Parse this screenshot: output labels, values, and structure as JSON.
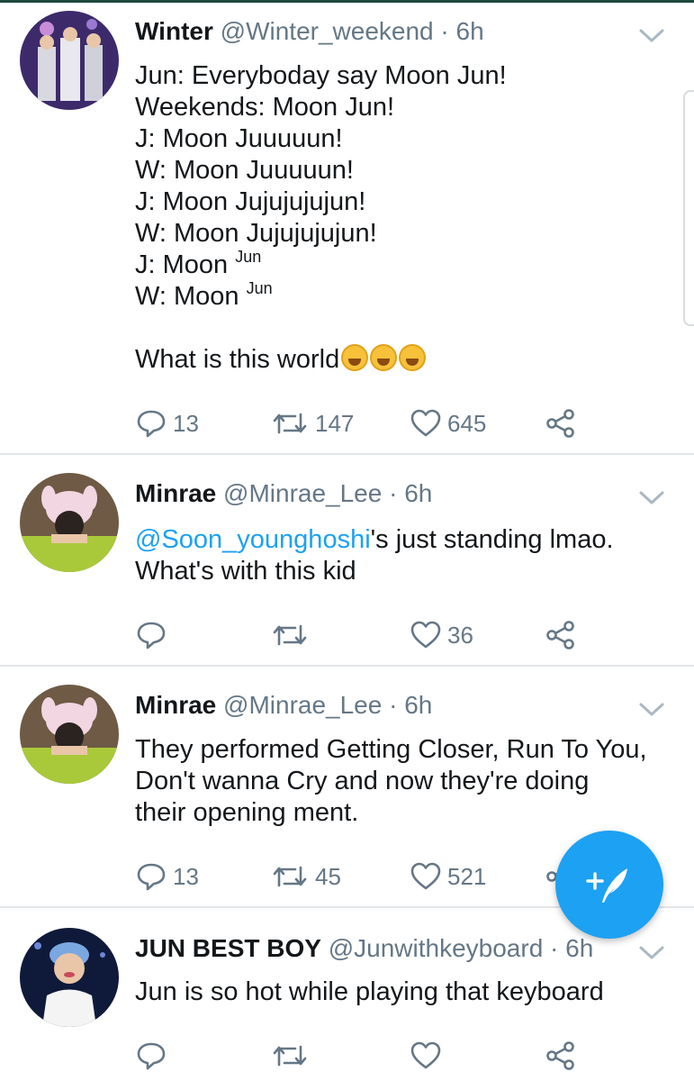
{
  "tweets": [
    {
      "name": "Winter",
      "handle": "@Winter_weekend",
      "time": "· 6h",
      "lines": [
        "Jun: Everyboday say Moon Jun!",
        "Weekends: Moon Jun!",
        "J: Moon Juuuuun!",
        "W: Moon Juuuuun!",
        "J: Moon Jujujujujun!",
        "W: Moon Jujujujujun!"
      ],
      "sup_lines": [
        {
          "prefix": "J: Moon ",
          "sup": "Jun"
        },
        {
          "prefix": "W: Moon ",
          "sup": "Jun"
        }
      ],
      "last_line": "What is this world",
      "emoji": [
        "grinning-squinting-face",
        "grinning-squinting-face",
        "grinning-squinting-face"
      ],
      "replies": "13",
      "retweets": "147",
      "likes": "645"
    },
    {
      "name": "Minrae",
      "handle": "@Minrae_Lee",
      "time": "· 6h",
      "mention": "@Soon_younghoshi",
      "line1_rest": "'s just standing lmao.",
      "line2": "What's with this kid",
      "replies": "",
      "retweets": "",
      "likes": "36"
    },
    {
      "name": "Minrae",
      "handle": "@Minrae_Lee",
      "time": "· 6h",
      "lines": [
        "They performed Getting Closer, Run To You,",
        "Don't wanna Cry and now they're doing",
        "their opening ment."
      ],
      "replies": "13",
      "retweets": "45",
      "likes": "521"
    },
    {
      "name": "JUN BEST BOY",
      "handle": "@Junwithkeyboard",
      "time": "· 6h",
      "lines": [
        "Jun is so hot while playing that keyboard"
      ],
      "replies": "",
      "retweets": "",
      "likes": ""
    }
  ],
  "colors": {
    "accent": "#1da1f2",
    "text": "#14171a",
    "muted": "#657786",
    "divider": "#e3e6e9"
  },
  "icons": [
    "reply-icon",
    "retweet-icon",
    "like-icon",
    "share-icon",
    "chevron-down-icon",
    "compose-tweet-icon"
  ]
}
